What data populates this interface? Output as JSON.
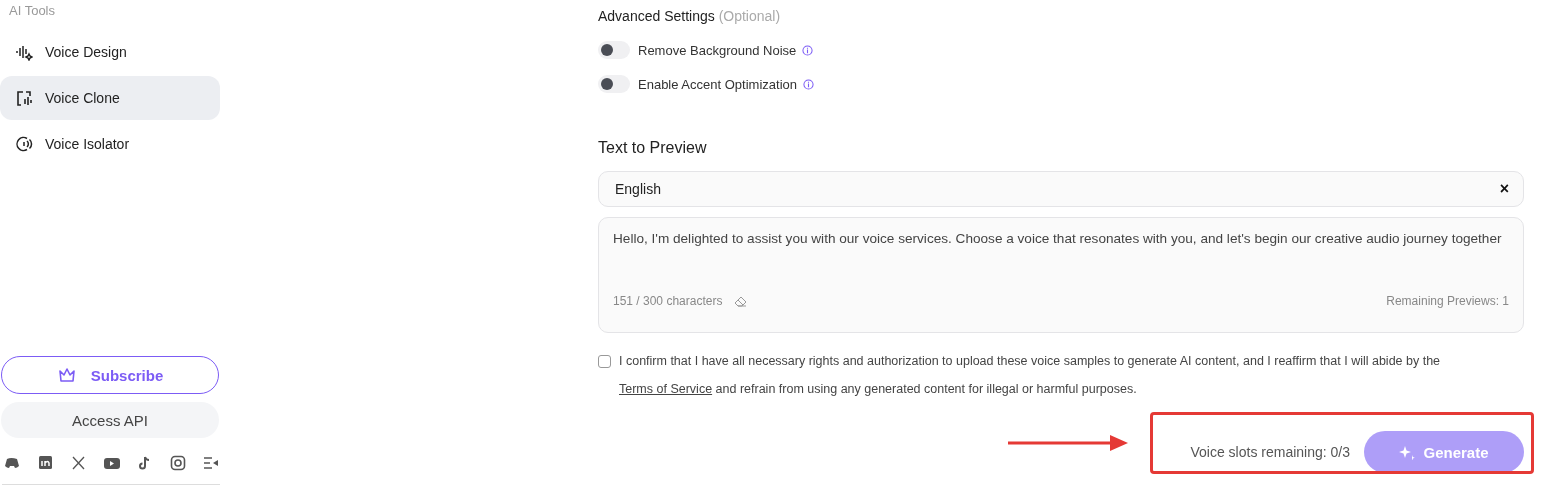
{
  "sidebar": {
    "section_title": "AI Tools",
    "items": [
      {
        "label": "Voice Design",
        "selected": false
      },
      {
        "label": "Voice Clone",
        "selected": true
      },
      {
        "label": "Voice Isolator",
        "selected": false
      }
    ],
    "subscribe_button": "Subscribe",
    "api_button": "Access API"
  },
  "advanced_settings": {
    "title": "Advanced Settings",
    "hint": "(Optional)",
    "toggles": [
      {
        "label": "Remove Background Noise",
        "on": false
      },
      {
        "label": "Enable Accent Optimization",
        "on": false
      }
    ]
  },
  "text_to_preview": {
    "title": "Text to Preview",
    "language": "English",
    "clear": "×",
    "text": "Hello, I'm delighted to assist you with our voice services. Choose a voice that resonates with you, and let's begin our creative audio journey together",
    "char_count": "151 / 300 characters",
    "remaining": "Remaining Previews: 1"
  },
  "consent": {
    "checked": false,
    "text_before": "I confirm that I have all necessary rights and authorization to upload these voice samples to generate AI content, and I reaffirm that I will abide by the",
    "link": "Terms of Service",
    "text_after": "and refrain from using any generated content for illegal or harmful purposes."
  },
  "footer": {
    "slots": "Voice slots remaining: 0/3",
    "generate_button": "Generate",
    "disabled": true
  }
}
